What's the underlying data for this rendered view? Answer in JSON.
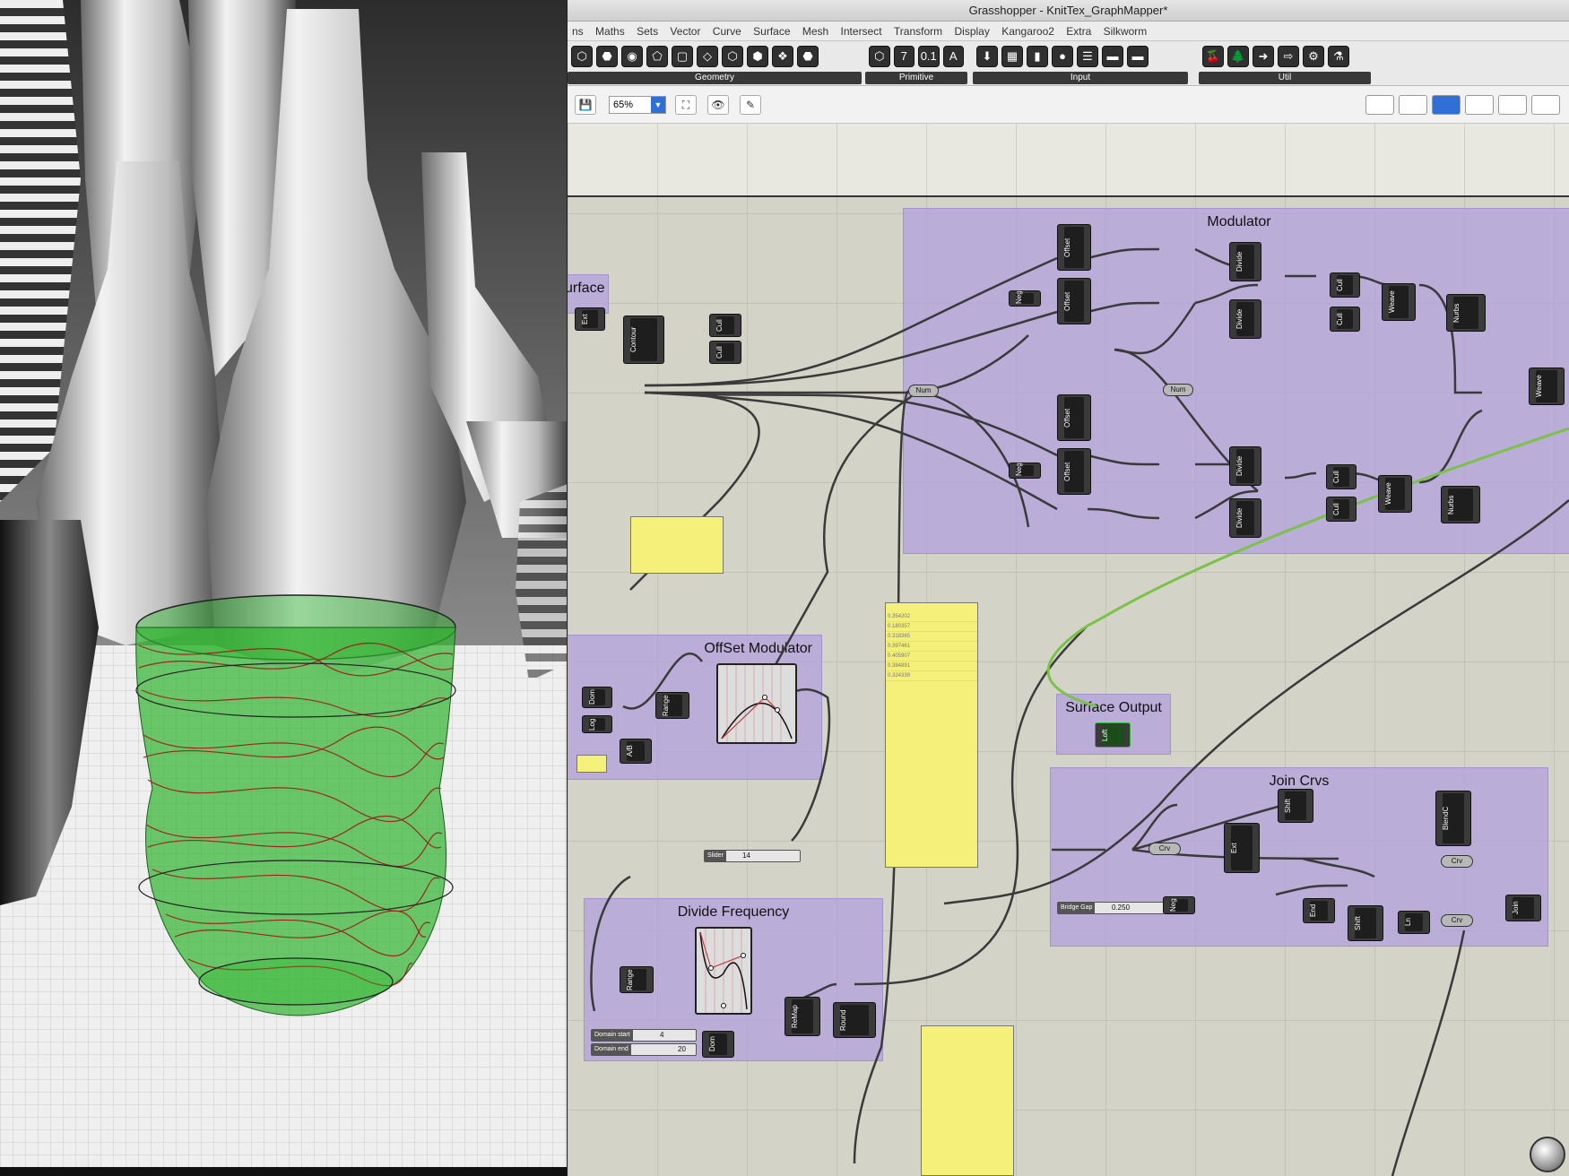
{
  "window": {
    "title": "Grasshopper - KnitTex_GraphMapper*"
  },
  "menu": [
    "ns",
    "Maths",
    "Sets",
    "Vector",
    "Curve",
    "Surface",
    "Mesh",
    "Intersect",
    "Transform",
    "Display",
    "Kangaroo2",
    "Extra",
    "Silkworm"
  ],
  "ribbon": {
    "groups": [
      {
        "label": "Geometry",
        "icons": [
          "⬡",
          "⬣",
          "◉",
          "⬠",
          "▢",
          "◇",
          "⬡",
          "⬢",
          "❖",
          "⬣"
        ]
      },
      {
        "label": "Primitive",
        "icons": [
          "⬡",
          "7",
          "0.1",
          "A"
        ]
      },
      {
        "label": "Input",
        "icons": [
          "⬇",
          "▦",
          "▮",
          "●",
          "☰",
          "▬",
          "▬",
          "▦"
        ]
      },
      {
        "label": "Util",
        "icons": [
          "🍒",
          "🌲",
          "➜",
          "⇨",
          "⚙",
          "⚗"
        ]
      }
    ]
  },
  "toolbar": {
    "zoom": "65%"
  },
  "groups": {
    "modulator": "Modulator",
    "surface": "urface",
    "offset": "OffSet Modulator",
    "surface_output": "Surface Output",
    "join": "Join Crvs",
    "divide": "Divide Frequency"
  },
  "components": {
    "ext": "Ext",
    "contour": "Contour",
    "cull1": "Cull",
    "cull2": "Cull",
    "offset1": "Offset",
    "offset2": "Offset",
    "offset3": "Offset",
    "offset4": "Offset",
    "neg1": "Neg",
    "neg2": "Neg",
    "neg3": "Neg",
    "num1": "Num",
    "num2": "Num",
    "divide1": "Divide",
    "divide2": "Divide",
    "divide3": "Divide",
    "divide4": "Divide",
    "cullA": "Cull",
    "cullB": "Cull",
    "cullC": "Cull",
    "cullD": "Cull",
    "weave1": "Weave",
    "weave2": "Weave",
    "weave3": "Weave",
    "nurbs1": "Nurbs",
    "nurbs2": "Nurbs",
    "dom1": "Dom",
    "log": "Log",
    "ab": "A/B",
    "range1": "Range",
    "loft": "Loft",
    "crv1": "Crv",
    "crv2": "Crv",
    "crv3": "Crv",
    "ext2": "Ext",
    "shift1": "Shift",
    "blend": "BlendC",
    "end": "End",
    "shift2": "Shift",
    "ln": "Ln",
    "join": "Join",
    "range2": "Range",
    "remap": "ReMap",
    "round": "Round",
    "dom2": "Dom"
  },
  "sliders": {
    "slider": {
      "label": "Slider",
      "value": "14"
    },
    "bridge": {
      "label": "Bridge Gap",
      "value": "0.250"
    },
    "dstart": {
      "label": "Domain start",
      "value": "4"
    },
    "dend": {
      "label": "Domain end",
      "value": "20"
    }
  },
  "panel_values": [
    "0.354202",
    "0.180357",
    "0.318365",
    "0.397461",
    "0.405907",
    "0.384891",
    "0.324339"
  ],
  "colors": {
    "group": "#b2a0de",
    "panel": "#f4f07a",
    "preview_green": "#2fb52f",
    "wire": "#3a3a3a"
  }
}
